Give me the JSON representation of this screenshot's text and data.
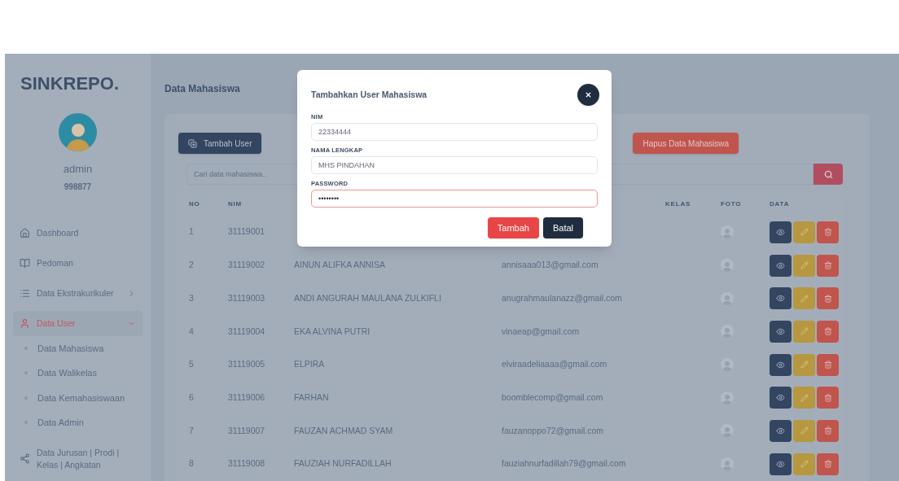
{
  "sidebar": {
    "logo": "SINKREPO.",
    "user": {
      "name": "admin",
      "id": "998877"
    },
    "items": [
      {
        "label": "Dashboard",
        "selected": false
      },
      {
        "label": "Pedoman",
        "selected": false
      },
      {
        "label": "Data Ekstrakurikuler",
        "selected": false,
        "expanded": false
      },
      {
        "label": "Data User",
        "selected": true,
        "expanded": true,
        "children": [
          {
            "label": "Data Mahasiswa"
          },
          {
            "label": "Data Walikelas"
          },
          {
            "label": "Data Kemahasiswaan"
          },
          {
            "label": "Data Admin"
          }
        ]
      },
      {
        "label": "Data Jurusan | Prodi | Kelas | Angkatan",
        "selected": false
      }
    ]
  },
  "page_title": "Data Mahasiswa",
  "toolbar": {
    "add_button": "Tambah User",
    "delete_button": "Hapus Data Mahasiswa",
    "search": {
      "placeholder": "Cari data mahasiswa.."
    }
  },
  "table": {
    "columns": [
      "NO",
      "NIM",
      "",
      "",
      "KELAS",
      "FOTO",
      "DATA"
    ],
    "rows": [
      {
        "no": "1",
        "nim": "31119001"
      },
      {
        "no": "2",
        "nim": "31119002",
        "name": "AINUN ALIFKA ANNISA",
        "email": "annisaaa013@gmail.com"
      },
      {
        "no": "3",
        "nim": "31119003",
        "name": "ANDI ANGURAH MAULANA ZULKIFLI",
        "email": "anugrahmaulanazz@gmail.com"
      },
      {
        "no": "4",
        "nim": "31119004",
        "name": "EKA ALVINA PUTRI",
        "email": "vinaeap@gmail.com"
      },
      {
        "no": "5",
        "nim": "31119005",
        "name": "ELPIRA",
        "email": "elviraadeliaaaa@gmail.com"
      },
      {
        "no": "6",
        "nim": "31119006",
        "name": "FARHAN",
        "email": "boomblecomp@gmail.com"
      },
      {
        "no": "7",
        "nim": "31119007",
        "name": "FAUZAN ACHMAD SYAM",
        "email": "fauzanoppo72@gmail.com"
      },
      {
        "no": "8",
        "nim": "31119008",
        "name": "FAUZIAH NURFADILLAH",
        "email": "fauziahnurfadillah79@gmail.com"
      }
    ]
  },
  "modal": {
    "title": "Tambahkan User Mahasiswa",
    "fields": [
      {
        "label": "NIM",
        "value": "22334444",
        "focused": false
      },
      {
        "label": "NAMA LENGKAP",
        "value": "MHS PINDAHAN",
        "focused": false
      },
      {
        "label": "PASSWORD",
        "value": "••••••••",
        "focused": true
      }
    ],
    "buttons": [
      {
        "label": "Tambah",
        "kind": "primary"
      },
      {
        "label": "Batal",
        "kind": "secondary"
      }
    ]
  }
}
